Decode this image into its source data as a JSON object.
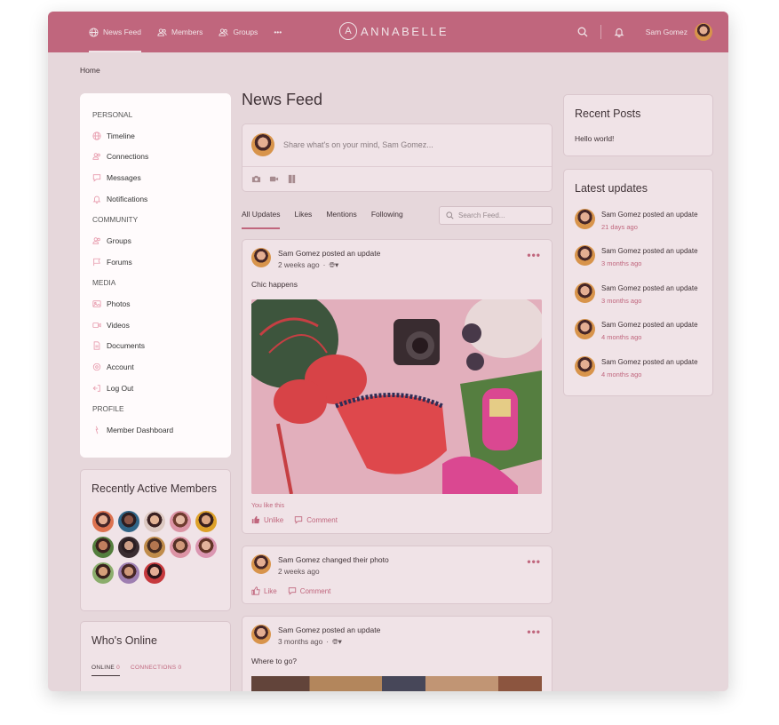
{
  "header": {
    "nav": [
      {
        "label": "News Feed",
        "icon": "globe-icon"
      },
      {
        "label": "Members",
        "icon": "people-icon"
      },
      {
        "label": "Groups",
        "icon": "people-icon"
      },
      {
        "label": "•••",
        "icon": "more-icon"
      }
    ],
    "logo_letter": "A",
    "logo_text": "ANNABELLE",
    "user_name": "Sam Gomez"
  },
  "breadcrumb": "Home",
  "sidebar": {
    "sections": [
      {
        "heading": "PERSONAL",
        "items": [
          {
            "label": "Timeline",
            "icon": "globe-icon"
          },
          {
            "label": "Connections",
            "icon": "people-icon"
          },
          {
            "label": "Messages",
            "icon": "chat-icon"
          },
          {
            "label": "Notifications",
            "icon": "bell-icon"
          }
        ]
      },
      {
        "heading": "COMMUNITY",
        "items": [
          {
            "label": "Groups",
            "icon": "people-icon"
          },
          {
            "label": "Forums",
            "icon": "flag-icon"
          }
        ]
      },
      {
        "heading": "MEDIA",
        "items": [
          {
            "label": "Photos",
            "icon": "image-icon"
          },
          {
            "label": "Videos",
            "icon": "video-icon"
          },
          {
            "label": "Documents",
            "icon": "document-icon"
          },
          {
            "label": "Account",
            "icon": "gear-icon"
          },
          {
            "label": "Log Out",
            "icon": "logout-icon"
          }
        ]
      },
      {
        "heading": "PROFILE",
        "items": [
          {
            "label": "Member Dashboard",
            "icon": "dashboard-icon"
          }
        ]
      }
    ]
  },
  "recently_active": {
    "title": "Recently Active Members",
    "count": 13
  },
  "whos_online": {
    "title": "Who's Online",
    "tabs": [
      {
        "label": "ONLINE",
        "count": "0"
      },
      {
        "label": "CONNECTIONS",
        "count": "0"
      }
    ]
  },
  "main": {
    "title": "News Feed",
    "composer_placeholder": "Share what's on your mind, Sam Gomez...",
    "tabs": [
      "All Updates",
      "Likes",
      "Mentions",
      "Following"
    ],
    "search_placeholder": "Search Feed...",
    "posts": [
      {
        "author_line": "Sam Gomez posted an update",
        "time": "2 weeks ago",
        "text": "Chic happens",
        "liked_text": "You like this",
        "action1": "Unlike",
        "action2": "Comment"
      },
      {
        "author_line": "Sam Gomez changed their photo",
        "time": "2 weeks ago",
        "action1": "Like",
        "action2": "Comment"
      },
      {
        "author_line": "Sam Gomez posted an update",
        "time": "3 months ago",
        "text": "Where to go?"
      }
    ]
  },
  "recent_posts": {
    "title": "Recent Posts",
    "items": [
      "Hello world!"
    ]
  },
  "latest_updates": {
    "title": "Latest updates",
    "items": [
      {
        "text": "Sam Gomez posted an update",
        "time": "21 days ago"
      },
      {
        "text": "Sam Gomez posted an update",
        "time": "3 months ago"
      },
      {
        "text": "Sam Gomez posted an update",
        "time": "3 months ago"
      },
      {
        "text": "Sam Gomez posted an update",
        "time": "4 months ago"
      },
      {
        "text": "Sam Gomez posted an update",
        "time": "4 months ago"
      }
    ]
  },
  "colors": {
    "accent": "#c86e84",
    "header": "#c86e84",
    "sidebar_bg": "#fffbfc"
  }
}
